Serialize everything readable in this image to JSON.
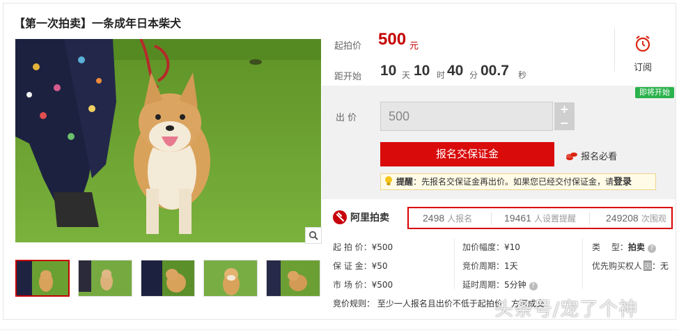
{
  "title": "【第一次拍卖】一条成年日本柴犬",
  "price": {
    "label": "起拍价",
    "value": "500",
    "unit": "元"
  },
  "countdown": {
    "label": "距开始",
    "days": "10",
    "days_unit": "天",
    "hours": "10",
    "hours_unit": "时",
    "minutes": "40",
    "minutes_unit": "分",
    "seconds": "00.7",
    "seconds_unit": "秒"
  },
  "subscribe": {
    "label": "订阅",
    "icon": "alarm-clock-icon"
  },
  "badge": "即将开始",
  "bid": {
    "label": "出 价",
    "value": "500",
    "plus": "+",
    "minus": "−"
  },
  "deposit_button": "报名交保证金",
  "must_read": "报名必看",
  "reminder": {
    "label": "提醒",
    "text": "：先报名交保证金再出价。如果您已经交付保证金，请",
    "link": "登录"
  },
  "brand": "阿里拍卖",
  "stats": [
    {
      "value": "2498",
      "label": "人报名"
    },
    {
      "value": "19461",
      "label": "人设置提醒"
    },
    {
      "value": "249208",
      "label": "次围观"
    }
  ],
  "details": {
    "start_price": {
      "label": "起 拍 价：",
      "value": "¥500"
    },
    "deposit": {
      "label": "保 证 金：",
      "value": "¥50"
    },
    "market_price": {
      "label": "市 场 价：",
      "value": "¥500"
    },
    "increment": {
      "label": "加价幅度：",
      "value": "¥10"
    },
    "cycle": {
      "label": "竞价周期：",
      "value": "1天"
    },
    "delay": {
      "label": "延时周期：",
      "value": "5分钟"
    },
    "type": {
      "label": "类　 型：",
      "value": "拍卖"
    },
    "priority": {
      "label": "优先购买权人",
      "badge": "因",
      "value": "：无"
    }
  },
  "rules": "竞价规则：  至少一人报名且出价不低于起拍价，方可成交",
  "watermark": "头条号/宠了个神",
  "colors": {
    "accent_red": "#c40000",
    "button_red": "#d90b0b",
    "badge_green": "#2bb24c"
  }
}
